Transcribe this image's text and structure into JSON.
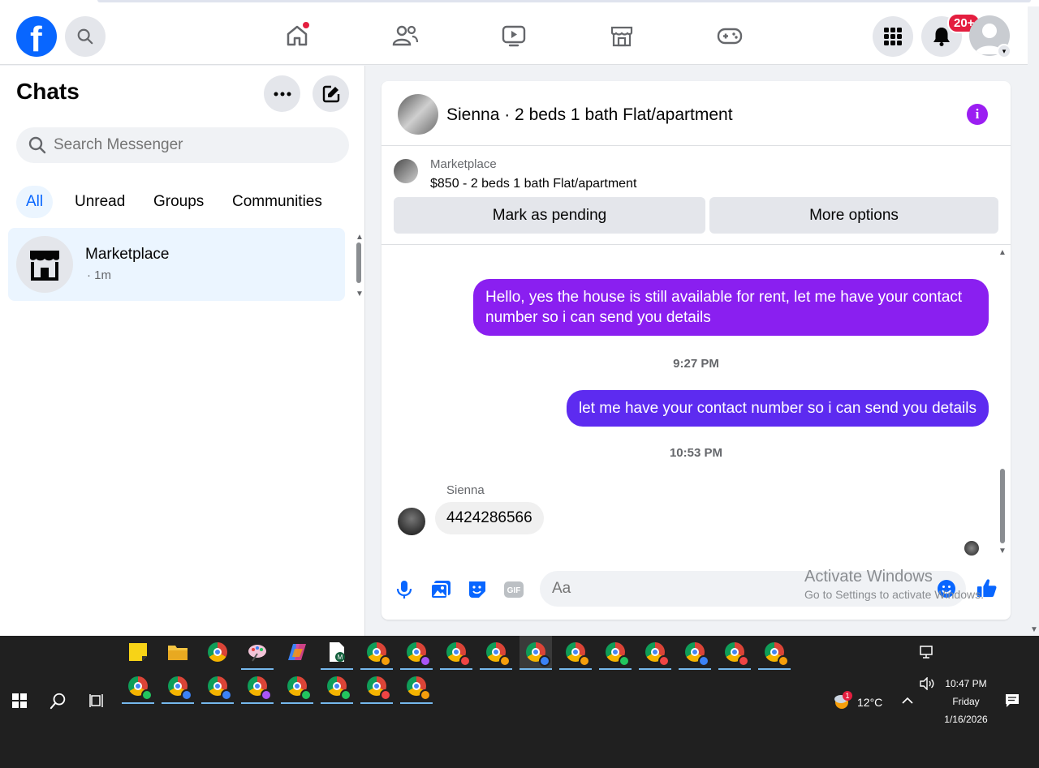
{
  "nav": {
    "logo_letter": "f",
    "notifications_badge": "20+"
  },
  "sidebar": {
    "title": "Chats",
    "search_placeholder": "Search Messenger",
    "filters": [
      "All",
      "Unread",
      "Groups",
      "Communities"
    ],
    "active_filter": "All",
    "chats": [
      {
        "name": "Marketplace",
        "time": "· 1m"
      }
    ]
  },
  "conversation": {
    "title": "Sienna · 2 beds 1 bath Flat/apartment",
    "marketplace_label": "Marketplace",
    "listing": "$850 - 2 beds 1 bath Flat/apartment",
    "buttons": {
      "mark_pending": "Mark as pending",
      "more_options": "More options"
    },
    "messages": [
      {
        "text": "Hello, yes the house is still available for rent, let me have your contact number so i can send you details",
        "direction": "outgoing"
      },
      {
        "timestamp": "9:27 PM"
      },
      {
        "text": "let me have your contact number so i can send you details",
        "direction": "outgoing"
      },
      {
        "timestamp": "10:53 PM"
      },
      {
        "sender": "Sienna",
        "text": "4424286566",
        "direction": "incoming"
      }
    ],
    "composer_placeholder": "Aa"
  },
  "watermark": {
    "line1": "Activate Windows",
    "line2": "Go to Settings to activate Windows."
  },
  "taskbar": {
    "weather": "12°C",
    "weather_badge": "1",
    "time": "10:47 PM",
    "day": "Friday",
    "date": "1/16/2026"
  },
  "colors": {
    "accent": "#0866ff",
    "bubble_purple": "#8a1ff0",
    "bubble_indigo": "#5d2bf0",
    "notification_red": "#e41e3f"
  }
}
